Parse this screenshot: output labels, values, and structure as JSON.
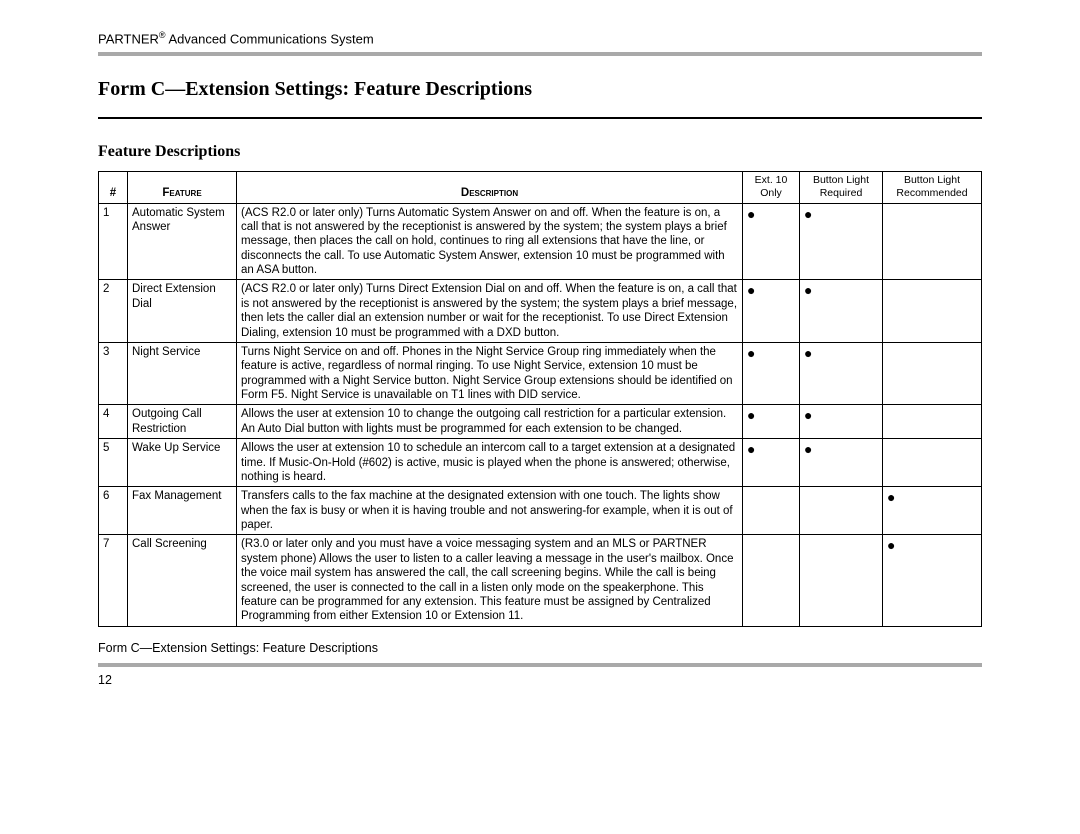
{
  "header": {
    "brand": "PARTNER",
    "reg": "®",
    "tail": " Advanced Communications System"
  },
  "title": "Form C—Extension Settings: Feature Descriptions",
  "section": "Feature Descriptions",
  "columns": {
    "num": "#",
    "feature": "Feature",
    "description": "Description",
    "ext10_l1": "Ext. 10",
    "ext10_l2": "Only",
    "blreq_l1": "Button Light",
    "blreq_l2": "Required",
    "blrec_l1": "Button Light",
    "blrec_l2": "Recommended"
  },
  "dot": "●",
  "rows": [
    {
      "n": "1",
      "feature": "Automatic System Answer",
      "desc": "(ACS R2.0 or later only) Turns Automatic System Answer on and off. When the feature is on, a call that is not answered by the receptionist is answered by the system; the system plays a brief message, then places the call on hold, continues to ring all extensions that have the line, or disconnects the call. To use Automatic System Answer, extension 10 must be programmed with an ASA button.",
      "ext10": true,
      "blreq": true,
      "blrec": false
    },
    {
      "n": "2",
      "feature": "Direct Extension Dial",
      "desc": "(ACS R2.0 or later only) Turns Direct Extension Dial on and off. When the feature is on, a call that is not answered by the receptionist is answered by the system; the system plays a brief message, then lets the caller dial an extension number or wait for the receptionist. To use Direct Extension Dialing, extension 10 must be programmed with a DXD button.",
      "ext10": true,
      "blreq": true,
      "blrec": false
    },
    {
      "n": "3",
      "feature": "Night Service",
      "desc": "Turns Night Service on and off. Phones in the Night Service Group ring immediately when the feature is active, regardless of normal ringing. To use Night Service, extension 10 must be programmed with a Night Service button. Night Service Group extensions should be identified on Form F5. Night Service is unavailable on T1 lines with DID service.",
      "ext10": true,
      "blreq": true,
      "blrec": false
    },
    {
      "n": "4",
      "feature": "Outgoing Call Restriction",
      "desc": "Allows the user at extension 10 to change the outgoing call restriction for a particular extension. An Auto Dial button with lights must be programmed for each extension to be changed.",
      "ext10": true,
      "blreq": true,
      "blrec": false
    },
    {
      "n": "5",
      "feature": "Wake Up Service",
      "desc": "Allows the user at extension 10 to schedule an intercom call to a target extension at a designated time. If Music-On-Hold (#602) is active, music is played when the phone is answered; otherwise, nothing is heard.",
      "ext10": true,
      "blreq": true,
      "blrec": false
    },
    {
      "n": "6",
      "feature": "Fax Management",
      "desc": "Transfers calls to the fax machine at the designated extension with one touch. The lights show when the fax is busy or when it is having trouble and not answering-for example, when it is out of paper.",
      "ext10": false,
      "blreq": false,
      "blrec": true
    },
    {
      "n": "7",
      "feature": "Call Screening",
      "desc": "(R3.0 or later only and you must have a voice messaging system and an MLS or PARTNER system phone) Allows the user to listen to a caller leaving a message in the user's mailbox. Once the voice mail system has answered the call, the call screening begins. While the call is being screened, the user is connected to the call in a listen only mode on the speakerphone. This feature can be programmed for any extension. This feature must be assigned by Centralized Programming from either Extension 10 or Extension 11.",
      "ext10": false,
      "blreq": false,
      "blrec": true
    }
  ],
  "footer_title": "Form C—Extension Settings: Feature Descriptions",
  "page_number": "12"
}
